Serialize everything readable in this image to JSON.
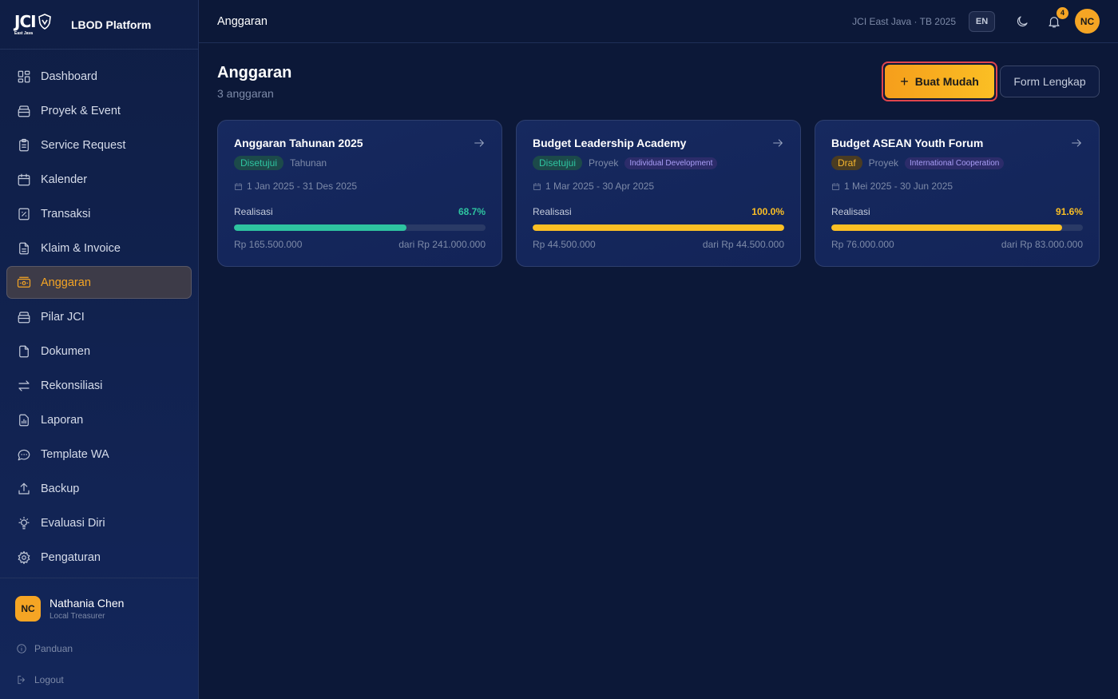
{
  "brand": {
    "logo_text": "JCI",
    "logo_sub": "East Java",
    "platform": "LBOD Platform"
  },
  "sidebar": {
    "items": [
      {
        "label": "Dashboard",
        "icon": "dashboard-icon"
      },
      {
        "label": "Proyek & Event",
        "icon": "briefcase-icon"
      },
      {
        "label": "Service Request",
        "icon": "clipboard-icon"
      },
      {
        "label": "Kalender",
        "icon": "calendar-icon"
      },
      {
        "label": "Transaksi",
        "icon": "receipt-icon"
      },
      {
        "label": "Klaim & Invoice",
        "icon": "file-text-icon"
      },
      {
        "label": "Anggaran",
        "icon": "wallet-icon",
        "active": true
      },
      {
        "label": "Pilar JCI",
        "icon": "pillar-icon"
      },
      {
        "label": "Dokumen",
        "icon": "document-icon"
      },
      {
        "label": "Rekonsiliasi",
        "icon": "swap-icon"
      },
      {
        "label": "Laporan",
        "icon": "report-icon"
      },
      {
        "label": "Template WA",
        "icon": "chat-icon"
      },
      {
        "label": "Backup",
        "icon": "upload-icon"
      },
      {
        "label": "Evaluasi Diri",
        "icon": "lightbulb-icon"
      },
      {
        "label": "Pengaturan",
        "icon": "gear-icon"
      }
    ],
    "user": {
      "initials": "NC",
      "name": "Nathania Chen",
      "role": "Local Treasurer"
    },
    "guide_label": "Panduan",
    "logout_label": "Logout"
  },
  "header": {
    "title": "Anggaran",
    "org": "JCI East Java · TB 2025",
    "lang": "EN",
    "notif_count": "4",
    "avatar": "NC"
  },
  "main": {
    "title": "Anggaran",
    "subtitle": "3 anggaran",
    "primary_button": "Buat Mudah",
    "secondary_button": "Form Lengkap",
    "realisasi_label": "Realisasi",
    "cards": [
      {
        "title": "Anggaran Tahunan 2025",
        "status": "Disetujui",
        "type": "Tahunan",
        "pillar": "",
        "dates": "1 Jan 2025 - 31 Des 2025",
        "percent_label": "68.7%",
        "progress": 0.687,
        "color": "#2ec4a0",
        "spent": "Rp 165.500.000",
        "total": "dari Rp 241.000.000"
      },
      {
        "title": "Budget Leadership Academy",
        "status": "Disetujui",
        "type": "Proyek",
        "pillar": "Individual Development",
        "dates": "1 Mar 2025 - 30 Apr 2025",
        "percent_label": "100.0%",
        "progress": 1.0,
        "color": "#fbbf24",
        "spent": "Rp 44.500.000",
        "total": "dari Rp 44.500.000"
      },
      {
        "title": "Budget ASEAN Youth Forum",
        "status": "Draf",
        "type": "Proyek",
        "pillar": "International Cooperation",
        "dates": "1 Mei 2025 - 30 Jun 2025",
        "percent_label": "91.6%",
        "progress": 0.916,
        "color": "#fbbf24",
        "spent": "Rp 76.000.000",
        "total": "dari Rp 83.000.000"
      }
    ]
  }
}
